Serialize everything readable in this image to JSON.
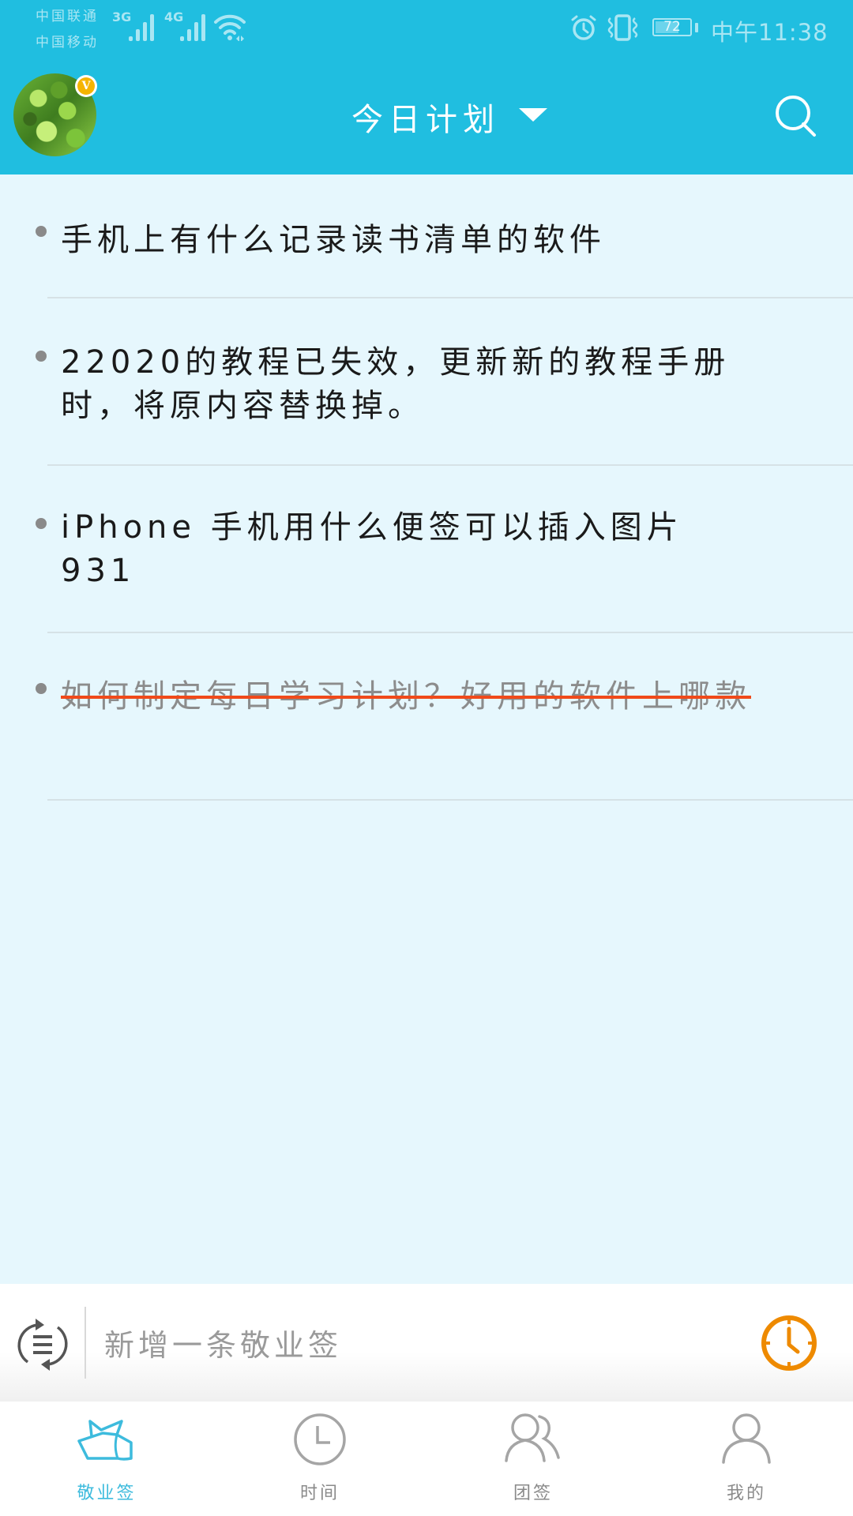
{
  "status_bar": {
    "carrier_1": "中国联通",
    "carrier_2": "中国移动",
    "network_1": "3G",
    "network_2": "4G",
    "battery_level": "72",
    "time": "中午11:38",
    "icons": [
      "signal-icon",
      "signal-icon",
      "wifi-icon",
      "alarm-icon",
      "vibrate-icon",
      "battery-icon"
    ]
  },
  "header": {
    "title": "今日计划",
    "avatar_badge": "V",
    "colors": {
      "background": "#20bee0",
      "text": "#ffffff"
    }
  },
  "notes": [
    {
      "text": "手机上有什么记录读书清单的软件",
      "done": false
    },
    {
      "text": "22020的教程已失效，更新新的教程手册时，将原内容替换掉。",
      "done": false
    },
    {
      "text": "iPhone  手机用什么便签可以插入图片931",
      "done": false
    },
    {
      "text": "如何制定每日学习计划？好用的软件上哪款",
      "done": true
    }
  ],
  "input_bar": {
    "placeholder": "新增一条敬业签",
    "value": "",
    "remind_color": "#ee8a00"
  },
  "tabs": [
    {
      "label": "敬业签",
      "icon": "note-icon",
      "active": true
    },
    {
      "label": "时间",
      "icon": "clock-icon",
      "active": false
    },
    {
      "label": "团签",
      "icon": "team-icon",
      "active": false
    },
    {
      "label": "我的",
      "icon": "person-icon",
      "active": false
    }
  ],
  "colors": {
    "accent": "#3dbbdd",
    "list_background": "#e6f7fd",
    "strike": "#f04a1a"
  }
}
